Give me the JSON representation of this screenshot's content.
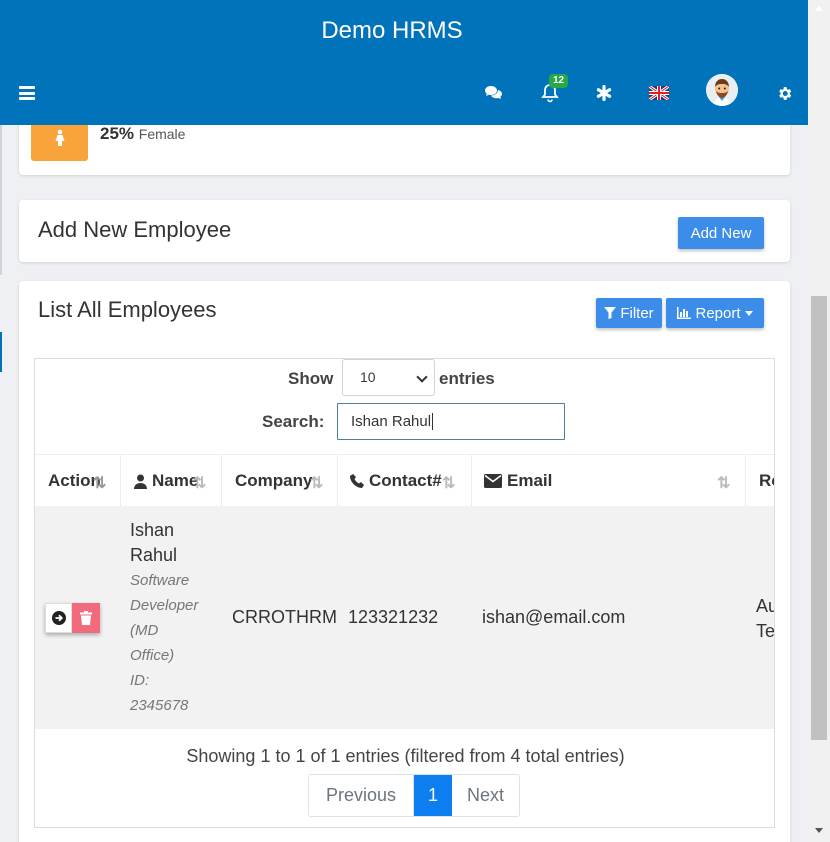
{
  "header": {
    "brand": "Demo HRMS",
    "notification_count": "12",
    "icons": [
      "menu-icon",
      "chat-icon",
      "bell-icon",
      "asterisk-icon",
      "flag-icon",
      "avatar",
      "gear-icon"
    ]
  },
  "stats": {
    "female_percent": "25%",
    "female_label": "Female"
  },
  "add_card": {
    "title": "Add New Employee",
    "button": "Add New"
  },
  "list_card": {
    "title": "List All Employees",
    "filter_button": "Filter",
    "report_button": "Report"
  },
  "datatable": {
    "show_label": "Show",
    "entries_label": "entries",
    "page_length": "10",
    "search_label": "Search:",
    "search_value": "Ishan Rahul",
    "columns": [
      "Action",
      "Name",
      "Company",
      "Contact#",
      "Email",
      "Ro"
    ],
    "rows": [
      {
        "name_line1": "Ishan",
        "name_line2": "Rahul",
        "role1": "Software",
        "role2": "Developer",
        "office1": "(MD",
        "office2": "Office)",
        "id_label": "ID:",
        "id_value": "2345678",
        "company": "CRROTHRM",
        "contact": "123321232",
        "email": "ishan@email.com",
        "extra1": "Au",
        "extra2": "Te"
      }
    ],
    "info": "Showing 1 to 1 of 1 entries (filtered from 4 total entries)",
    "pagination": {
      "previous": "Previous",
      "current": "1",
      "next": "Next"
    }
  },
  "colors": {
    "header_bg": "#0073ba",
    "primary_button": "#3c8dea",
    "female_box": "#f9a43a",
    "delete_button": "#f16b7c",
    "active_page": "#0d7ef0"
  }
}
